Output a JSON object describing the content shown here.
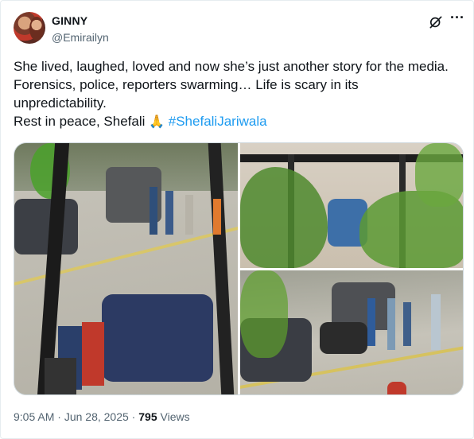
{
  "author": {
    "name": "GINNY",
    "handle": "@Emirailyn"
  },
  "tweet": {
    "line1": "She lived, laughed, loved and now she’s just another story for the media.",
    "line2": "Forensics, police, reporters swarming… Life is scary in its",
    "line3": "unpredictability.",
    "line4_text": "Rest in peace, Shefali ",
    "emoji": "🙏",
    "hashtag": "#ShefaliJariwala"
  },
  "footer": {
    "time": "9:05 AM",
    "separator1": " · ",
    "date": "Jun 28, 2025",
    "separator2": " · ",
    "views_count": "795",
    "views_label": " Views"
  },
  "icons": {
    "grok": "grok-icon",
    "more": "more-icon"
  },
  "colors": {
    "text": "#0f1419",
    "secondary": "#536471",
    "link": "#1d9bf0"
  }
}
